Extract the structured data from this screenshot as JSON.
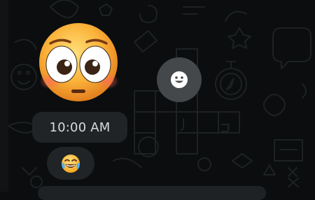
{
  "message": {
    "timestamp": "10:00 AM",
    "sticker": "flushed-face-sticker",
    "reaction": "joy-face-emoji"
  },
  "actions": {
    "react_icon": "smiley-face-icon"
  },
  "colors": {
    "background": "#0b0d0e",
    "bubble": "#202426",
    "react_button": "#45484b",
    "text": "#d7dbdd"
  }
}
